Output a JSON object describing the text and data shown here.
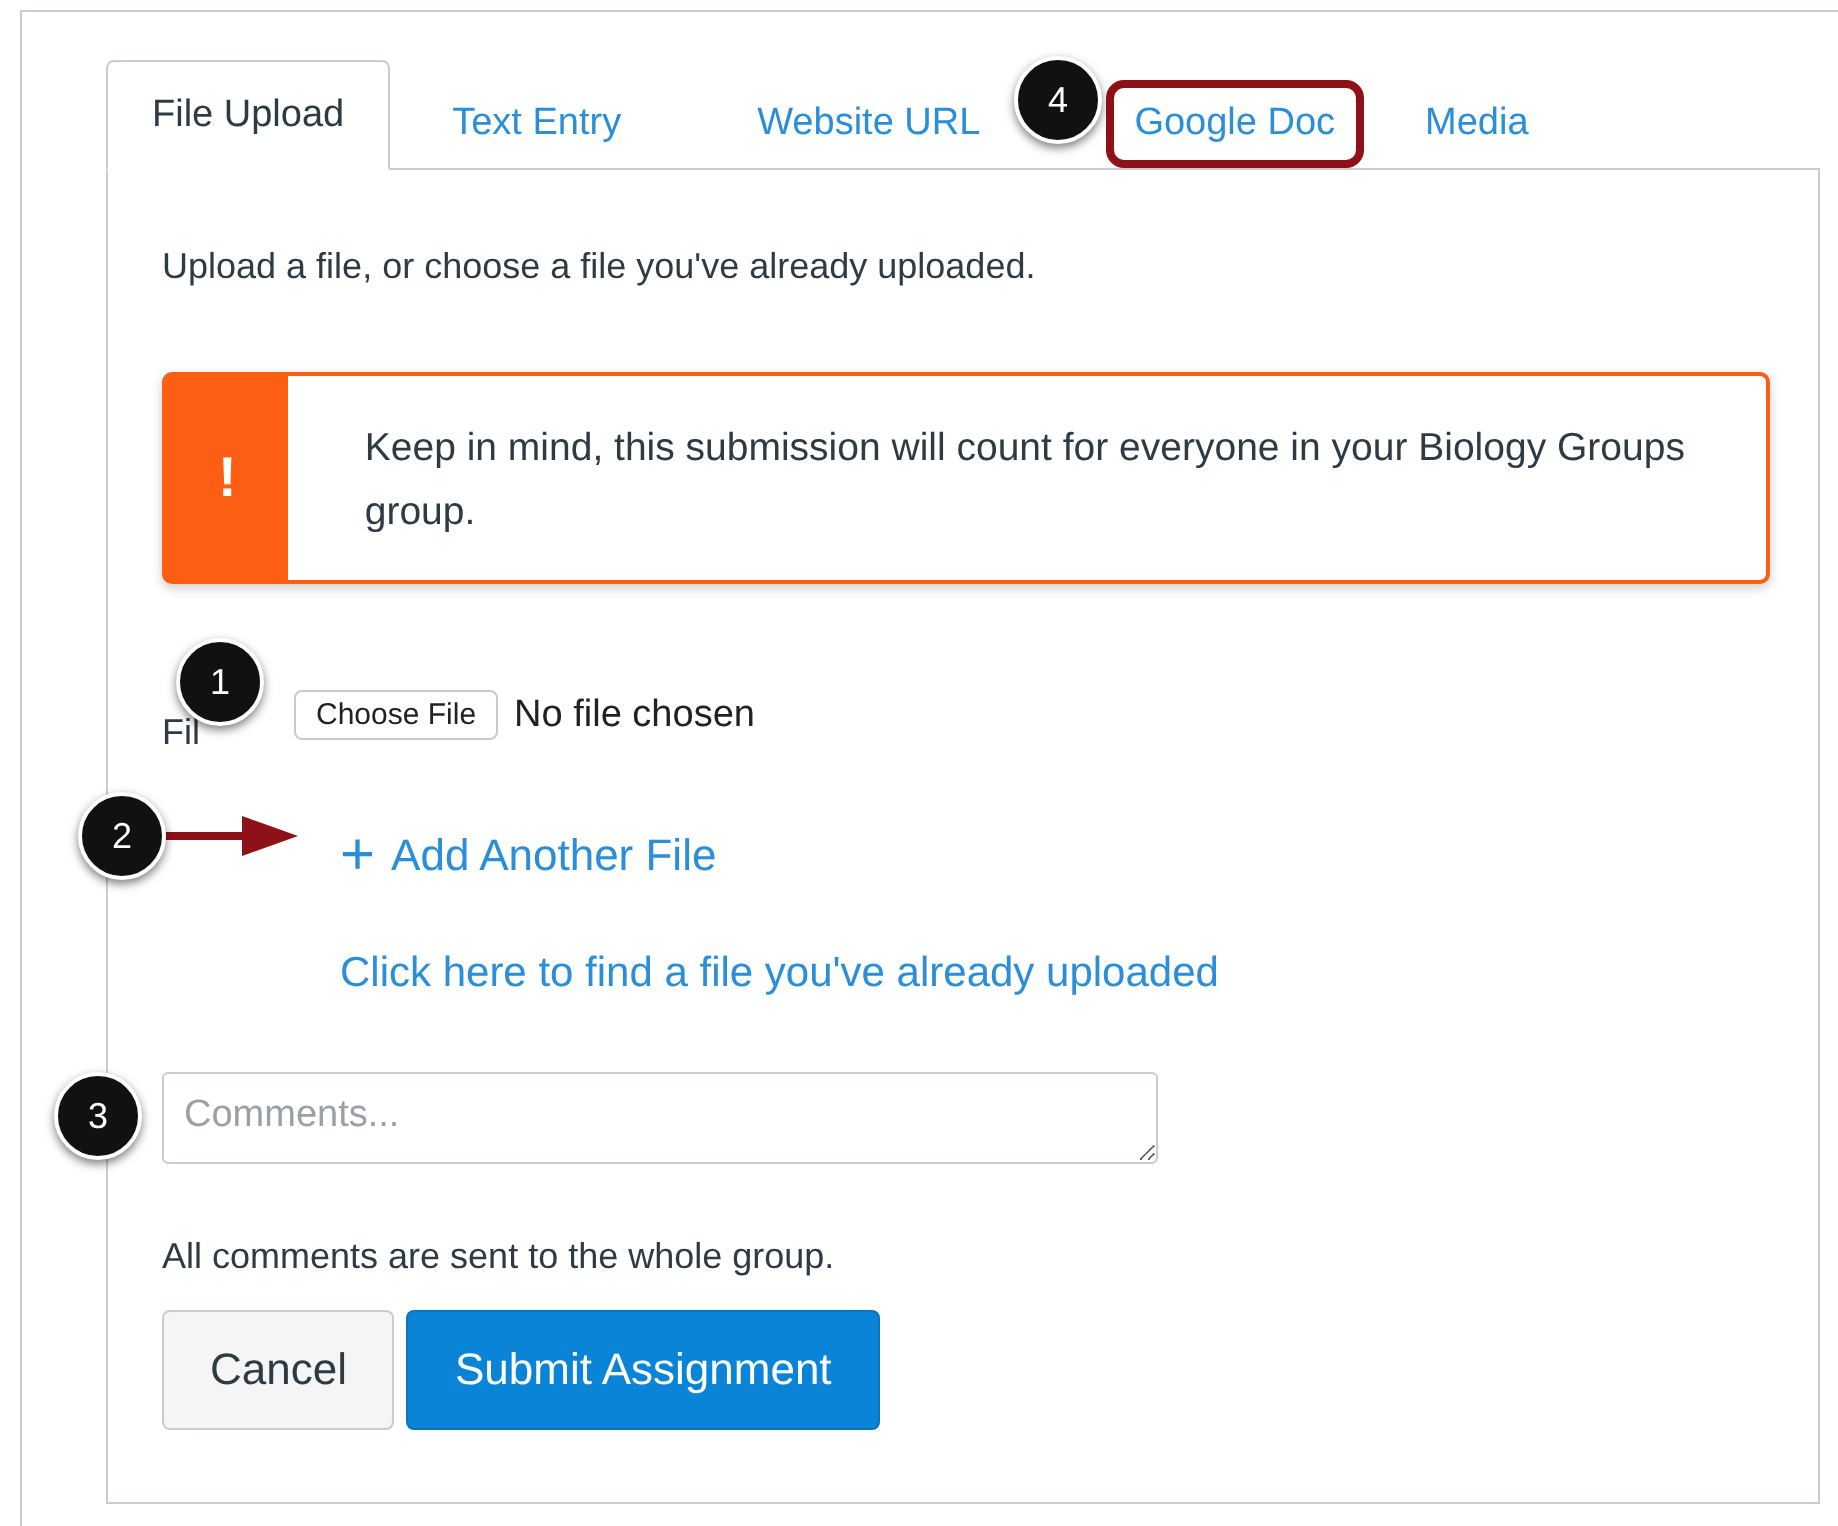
{
  "tabs": [
    {
      "label": "File Upload",
      "selected": true,
      "highlighted": false
    },
    {
      "label": "Text Entry",
      "selected": false,
      "highlighted": false
    },
    {
      "label": "Website URL",
      "selected": false,
      "highlighted": false
    },
    {
      "label": "Google Doc",
      "selected": false,
      "highlighted": true
    },
    {
      "label": "Media",
      "selected": false,
      "highlighted": false
    }
  ],
  "intro": "Upload a file, or choose a file you've already uploaded.",
  "alert": {
    "icon": "!",
    "text": "Keep in mind, this submission will count for everyone in your Biology Groups group."
  },
  "file_field": {
    "label": "Fil",
    "button": "Choose File",
    "status": "No file chosen"
  },
  "add_file_link": {
    "icon": "+",
    "label": "Add Another File"
  },
  "find_file_link": "Click here to find a file you've already uploaded",
  "comments": {
    "placeholder": "Comments..."
  },
  "comments_note": "All comments are sent to the whole group.",
  "buttons": [
    {
      "label": "Cancel",
      "kind": "secondary"
    },
    {
      "label": "Submit Assignment",
      "kind": "primary"
    }
  ],
  "callouts": [
    {
      "number": "1",
      "kind": "badge"
    },
    {
      "number": "2",
      "kind": "arrow"
    },
    {
      "number": "3",
      "kind": "badge"
    },
    {
      "number": "4",
      "kind": "badge"
    }
  ]
}
